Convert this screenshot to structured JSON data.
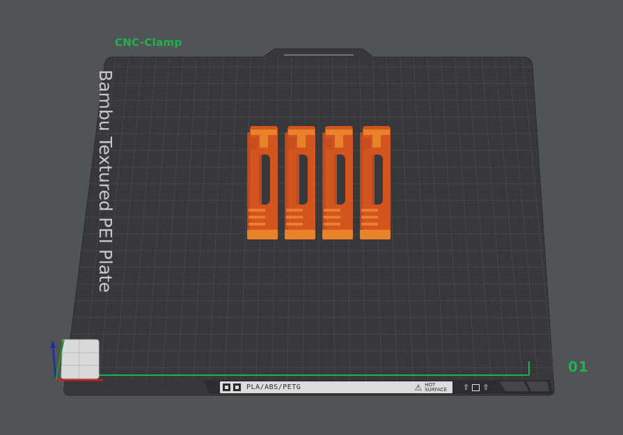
{
  "plate": {
    "name": "CNC-Clamp",
    "number": "01",
    "brand_text": "Bambu Textured PEI Plate",
    "material_label": "PLA/ABS/PETG",
    "hot_surface_line1": "HOT",
    "hot_surface_line2": "SURFACE"
  },
  "scene": {
    "part_count": 4,
    "part_color": "#d2541f",
    "part_highlight_color": "#e8812a",
    "plate_color": "#3a3a3d",
    "grid_color": "#4a4a4e",
    "accent_green": "#1fb24e",
    "background_color": "#525357"
  },
  "icons": {
    "axis": "xyz-axis-gizmo-icon",
    "warning": "hot-surface-warning-icon",
    "material": "filament-type-icon"
  }
}
